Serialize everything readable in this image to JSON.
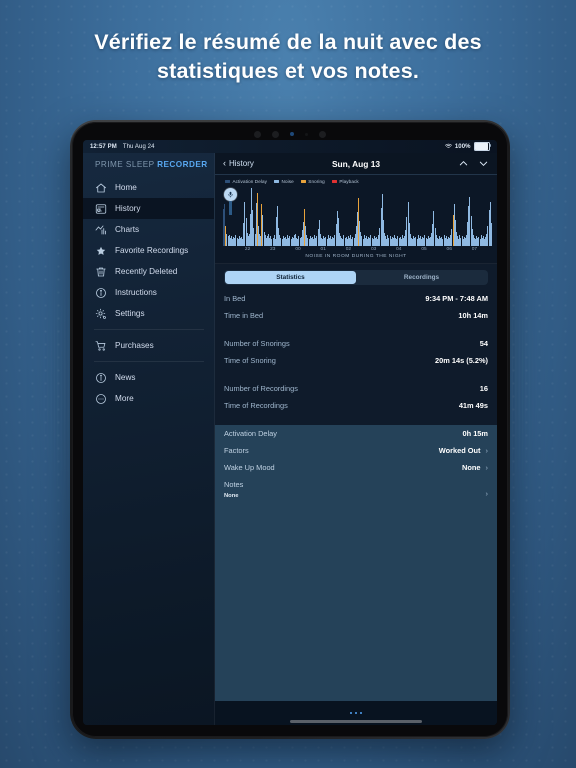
{
  "promo": {
    "headline": "Vérifiez le résumé de la nuit avec des statistiques et vos notes.",
    "bg_color": "#3d6f9d"
  },
  "status_bar": {
    "time": "12:57 PM",
    "date": "Thu Aug 24",
    "wifi_icon": "wifi-icon",
    "battery_percent": "100%",
    "battery_icon": "battery-full-icon"
  },
  "sidebar": {
    "brand_prefix": "PRIME SLEEP",
    "brand_suffix": "RECORDER",
    "items": [
      {
        "label": "Home",
        "icon": "home-icon",
        "active": false
      },
      {
        "label": "History",
        "icon": "history-icon",
        "active": true
      },
      {
        "label": "Charts",
        "icon": "charts-icon",
        "active": false
      },
      {
        "label": "Favorite Recordings",
        "icon": "star-icon",
        "active": false
      },
      {
        "label": "Recently Deleted",
        "icon": "trash-icon",
        "active": false
      },
      {
        "label": "Instructions",
        "icon": "info-icon",
        "active": false
      },
      {
        "label": "Settings",
        "icon": "gear-icon",
        "active": false
      }
    ],
    "group2": [
      {
        "label": "Purchases",
        "icon": "cart-icon"
      }
    ],
    "group3": [
      {
        "label": "News",
        "icon": "news-icon"
      },
      {
        "label": "More",
        "icon": "more-icon"
      }
    ]
  },
  "navbar": {
    "back_label": "History",
    "back_icon": "chevron-left-icon",
    "title": "Sun, Aug 13",
    "prev_icon": "chevron-up-icon",
    "next_icon": "chevron-down-icon"
  },
  "chart_data": {
    "type": "bar",
    "title": "",
    "xlabel": "NOISE IN ROOM DURING THE NIGHT",
    "ylabel": "",
    "grid": false,
    "legend_position": "top-left",
    "legend": [
      {
        "name": "Activation Delay",
        "color": "#2d4f78"
      },
      {
        "name": "Noise",
        "color": "#8fb9e2"
      },
      {
        "name": "Snoring",
        "color": "#e8a33c"
      },
      {
        "name": "Playback",
        "color": "#e03232"
      }
    ],
    "tick_labels": [
      "22",
      "23",
      "00",
      "01",
      "02",
      "03",
      "04",
      "05",
      "06",
      "07"
    ],
    "categories": [
      "22",
      "23",
      "00",
      "01",
      "02",
      "03",
      "04",
      "05",
      "06",
      "07"
    ],
    "ylim": [
      0,
      100
    ],
    "series": [
      {
        "name": "Noise",
        "color": "#8fb9e2",
        "values": [
          62,
          70,
          34,
          20,
          16,
          18,
          14,
          16,
          12,
          15,
          13,
          18,
          14,
          12,
          16,
          13,
          15,
          12,
          38,
          74,
          46,
          22,
          16,
          20,
          54,
          96,
          60,
          30,
          20,
          72,
          88,
          34,
          20,
          16,
          70,
          52,
          24,
          18,
          14,
          16,
          20,
          13,
          16,
          12,
          14,
          18,
          12,
          48,
          66,
          30,
          18,
          14,
          12,
          16,
          13,
          15,
          12,
          18,
          14,
          16,
          12,
          15,
          13,
          18,
          20,
          14,
          12,
          16,
          13,
          15,
          26,
          40,
          62,
          34,
          18,
          14,
          12,
          16,
          13,
          15,
          12,
          18,
          14,
          16,
          28,
          44,
          20,
          14,
          12,
          16,
          13,
          15,
          12,
          18,
          14,
          16,
          12,
          15,
          13,
          18,
          36,
          58,
          46,
          22,
          16,
          14,
          12,
          18,
          13,
          15,
          12,
          16,
          14,
          18,
          12,
          15,
          13,
          20,
          34,
          56,
          78,
          42,
          24,
          16,
          12,
          18,
          14,
          16,
          12,
          15,
          13,
          18,
          14,
          12,
          16,
          13,
          15,
          12,
          18,
          30,
          64,
          86,
          44,
          22,
          16,
          12,
          18,
          14,
          16,
          12,
          15,
          13,
          18,
          14,
          12,
          16,
          13,
          15,
          12,
          18,
          14,
          16,
          26,
          48,
          74,
          38,
          20,
          14,
          12,
          16,
          13,
          15,
          12,
          18,
          14,
          16,
          12,
          15,
          13,
          18,
          14,
          12,
          16,
          13,
          15,
          22,
          36,
          58,
          30,
          18,
          14,
          12,
          16,
          13,
          15,
          12,
          18,
          14,
          16,
          12,
          15,
          13,
          18,
          28,
          52,
          70,
          44,
          24,
          16,
          12,
          18,
          14,
          16,
          12,
          15,
          13,
          18,
          40,
          66,
          82,
          50,
          28,
          18,
          14,
          12,
          16,
          13,
          15,
          12,
          18,
          14,
          16,
          12,
          15,
          20,
          34,
          60,
          74,
          38
        ]
      },
      {
        "name": "Snoring",
        "color": "#e8a33c",
        "values": [
          0,
          0,
          28,
          0,
          0,
          0,
          0,
          0,
          0,
          0,
          0,
          0,
          0,
          0,
          0,
          0,
          0,
          0,
          0,
          0,
          0,
          0,
          0,
          0,
          0,
          0,
          0,
          0,
          0,
          0,
          56,
          0,
          0,
          0,
          46,
          0,
          0,
          0,
          0,
          0,
          0,
          0,
          0,
          0,
          0,
          0,
          0,
          0,
          0,
          0,
          0,
          0,
          0,
          0,
          0,
          0,
          0,
          0,
          0,
          0,
          0,
          0,
          0,
          0,
          0,
          0,
          0,
          0,
          0,
          0,
          0,
          0,
          42,
          0,
          0,
          0,
          0,
          0,
          0,
          0,
          0,
          0,
          0,
          0,
          0,
          0,
          0,
          0,
          0,
          0,
          0,
          0,
          0,
          0,
          0,
          0,
          0,
          0,
          0,
          0,
          0,
          0,
          0,
          0,
          0,
          0,
          0,
          0,
          0,
          0,
          0,
          0,
          0,
          0,
          0,
          0,
          0,
          0,
          0,
          0,
          80,
          0,
          0,
          0,
          0,
          0,
          0,
          0,
          0,
          0,
          0,
          0,
          0,
          0,
          0,
          0,
          0,
          0,
          0,
          0,
          0,
          0,
          0,
          0,
          0,
          0,
          0,
          0,
          0,
          0,
          0,
          0,
          0,
          0,
          0,
          0,
          0,
          0,
          0,
          0,
          0,
          0,
          0,
          0,
          0,
          0,
          0,
          0,
          0,
          0,
          0,
          0,
          0,
          0,
          0,
          0,
          0,
          0,
          0,
          0,
          0,
          0,
          0,
          0,
          0,
          0,
          0,
          0,
          0,
          0,
          0,
          0,
          0,
          0,
          0,
          0,
          0,
          0,
          0,
          0,
          0,
          0,
          0,
          0,
          48,
          0,
          0,
          0,
          0,
          0,
          0,
          0,
          0,
          0,
          0,
          0,
          0,
          0,
          0,
          0,
          0,
          0,
          0,
          0,
          0,
          0,
          0,
          0,
          0,
          0,
          0,
          0,
          0,
          0,
          0,
          0,
          0,
          0,
          0
        ]
      },
      {
        "name": "Activation Delay",
        "color": "#2d4f78",
        "values": [
          62,
          70,
          0,
          0,
          0,
          0,
          0,
          0,
          0,
          0,
          0,
          0,
          0,
          0,
          0,
          0,
          0,
          0,
          0,
          0,
          0,
          0,
          0,
          0,
          0,
          0,
          0,
          0,
          0,
          0,
          0,
          0,
          0,
          0,
          0,
          0,
          0,
          0,
          0,
          0,
          0,
          0,
          0,
          0,
          0,
          0,
          0,
          0,
          0,
          0,
          0,
          0,
          0,
          0,
          0,
          0,
          0,
          0,
          0,
          0,
          0,
          0,
          0,
          0,
          0,
          0,
          0,
          0,
          0,
          0,
          0,
          0,
          0,
          0,
          0,
          0,
          0,
          0,
          0,
          0,
          0,
          0,
          0,
          0,
          0,
          0,
          0,
          0,
          0,
          0,
          0,
          0,
          0,
          0,
          0,
          0,
          0,
          0,
          0,
          0,
          0,
          0,
          0,
          0,
          0,
          0,
          0,
          0,
          0,
          0,
          0,
          0,
          0,
          0,
          0,
          0,
          0,
          0,
          0,
          0,
          0,
          0,
          0,
          0,
          0,
          0,
          0,
          0,
          0,
          0,
          0,
          0,
          0,
          0,
          0,
          0,
          0,
          0,
          0,
          0,
          0,
          0,
          0,
          0,
          0,
          0,
          0,
          0,
          0,
          0,
          0,
          0,
          0,
          0,
          0,
          0,
          0,
          0,
          0,
          0,
          0,
          0,
          0,
          0,
          0,
          0,
          0,
          0,
          0,
          0,
          0,
          0,
          0,
          0,
          0,
          0,
          0,
          0,
          0,
          0,
          0,
          0,
          0,
          0,
          0,
          0,
          0,
          0,
          0,
          0,
          0,
          0,
          0,
          0,
          0,
          0,
          0,
          0,
          0,
          0,
          0,
          0,
          0,
          0,
          0,
          0,
          0,
          0,
          0,
          0,
          0,
          0,
          0,
          0,
          0,
          0,
          0,
          0,
          0,
          0,
          0,
          0,
          0,
          0,
          0,
          0,
          0,
          0,
          0,
          0,
          0,
          0,
          0,
          0,
          0,
          0,
          0,
          0,
          0
        ]
      }
    ],
    "mic_icon": "microphone-icon"
  },
  "segmented": {
    "options": [
      "Statistics",
      "Recordings"
    ],
    "selected": "Statistics"
  },
  "stats": {
    "group1": [
      {
        "label": "In Bed",
        "value": "9:34 PM - 7:48 AM"
      },
      {
        "label": "Time in Bed",
        "value": "10h 14m"
      }
    ],
    "group2": [
      {
        "label": "Number of Snorings",
        "value": "54"
      },
      {
        "label": "Time of Snoring",
        "value": "20m 14s (5.2%)"
      }
    ],
    "group3": [
      {
        "label": "Number of Recordings",
        "value": "16"
      },
      {
        "label": "Time of Recordings",
        "value": "41m 49s"
      }
    ]
  },
  "details": {
    "rows": [
      {
        "label": "Activation Delay",
        "value": "0h 15m",
        "chevron": false
      },
      {
        "label": "Factors",
        "value": "Worked Out",
        "chevron": true
      },
      {
        "label": "Wake Up Mood",
        "value": "None",
        "chevron": true
      }
    ],
    "notes_label": "Notes",
    "notes_value": "None",
    "notes_chevron": "chevron-right-icon"
  },
  "footer": {
    "page_dots": 3,
    "home_indicator": "home-indicator"
  }
}
